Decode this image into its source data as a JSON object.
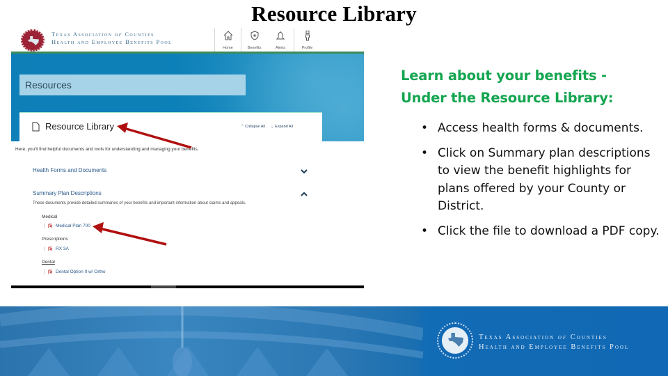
{
  "slide": {
    "title": "Resource Library"
  },
  "screenshot": {
    "org": {
      "line1_a": "Texas Association",
      "line1_of": "of",
      "line1_b": "Counties",
      "line2": "Health and Employee Benefits Pool"
    },
    "nav": [
      {
        "label": "Home",
        "icon": "home-icon"
      },
      {
        "label": "Benefits",
        "icon": "shield-icon"
      },
      {
        "label": "Alerts",
        "icon": "bell-icon"
      },
      {
        "label": "Profile",
        "icon": "person-icon"
      }
    ],
    "section_title": "Resources",
    "card": {
      "title": "Resource Library",
      "collapse_all": "Collapse All",
      "expand_all": "Expand All"
    },
    "intro": "Here, you'll find helpful documents and tools for understanding and managing your benefits.",
    "accordions": [
      {
        "label": "Health Forms and Documents",
        "state": "collapsed"
      },
      {
        "label": "Summary Plan Descriptions",
        "state": "expanded",
        "description": "These documents provide detailed summaries of your benefits and important information about claims and appeals."
      }
    ],
    "categories": [
      {
        "label": "Medical",
        "file": "Medical Plan 700"
      },
      {
        "label": "Prescriptions",
        "file": "RX 3A"
      },
      {
        "label": "Dental",
        "file": "Dental Option II w/ Ortho"
      }
    ]
  },
  "panel": {
    "heading_line1": "Learn about your benefits -",
    "heading_line2": "Under the Resource Library:",
    "bullets": [
      "Access health forms & documents.",
      "Click on Summary plan descriptions to view the benefit highlights for plans offered by your County or District.",
      "Click the file to download a PDF copy."
    ]
  },
  "footer": {
    "line1_a": "Texas Association",
    "line1_of": "of",
    "line1_b": "Counties",
    "line2": "Health and Employee Benefits Pool"
  },
  "colors": {
    "heading_green": "#14a550",
    "banner_blue": "#0c80b8",
    "arrow_red": "#b01010",
    "footer_blue": "#1168b4"
  }
}
